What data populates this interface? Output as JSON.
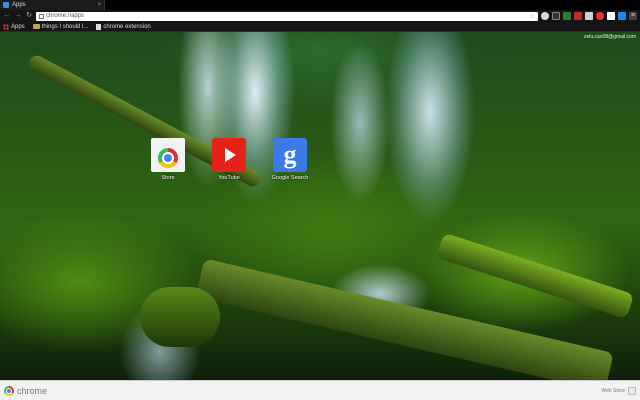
{
  "window": {
    "tab_title": "Apps"
  },
  "toolbar": {
    "address": "chrome://apps"
  },
  "bookmarks": [
    {
      "label": "Apps"
    },
    {
      "label": "things I should l..."
    },
    {
      "label": "chrome extension"
    }
  ],
  "user": {
    "email": "zelu.cao08@gmail.com"
  },
  "apps": [
    {
      "label": "Store",
      "icon": "webstore-icon"
    },
    {
      "label": "YouTube",
      "icon": "youtube-icon"
    },
    {
      "label": "Google Search",
      "icon": "google-search-icon"
    }
  ],
  "footer": {
    "brand": "chrome",
    "webstore_label": "Web Store"
  },
  "colors": {
    "youtube": "#e62117",
    "google_search": "#3b7ae8",
    "store_bg": "#f2f2f2"
  }
}
